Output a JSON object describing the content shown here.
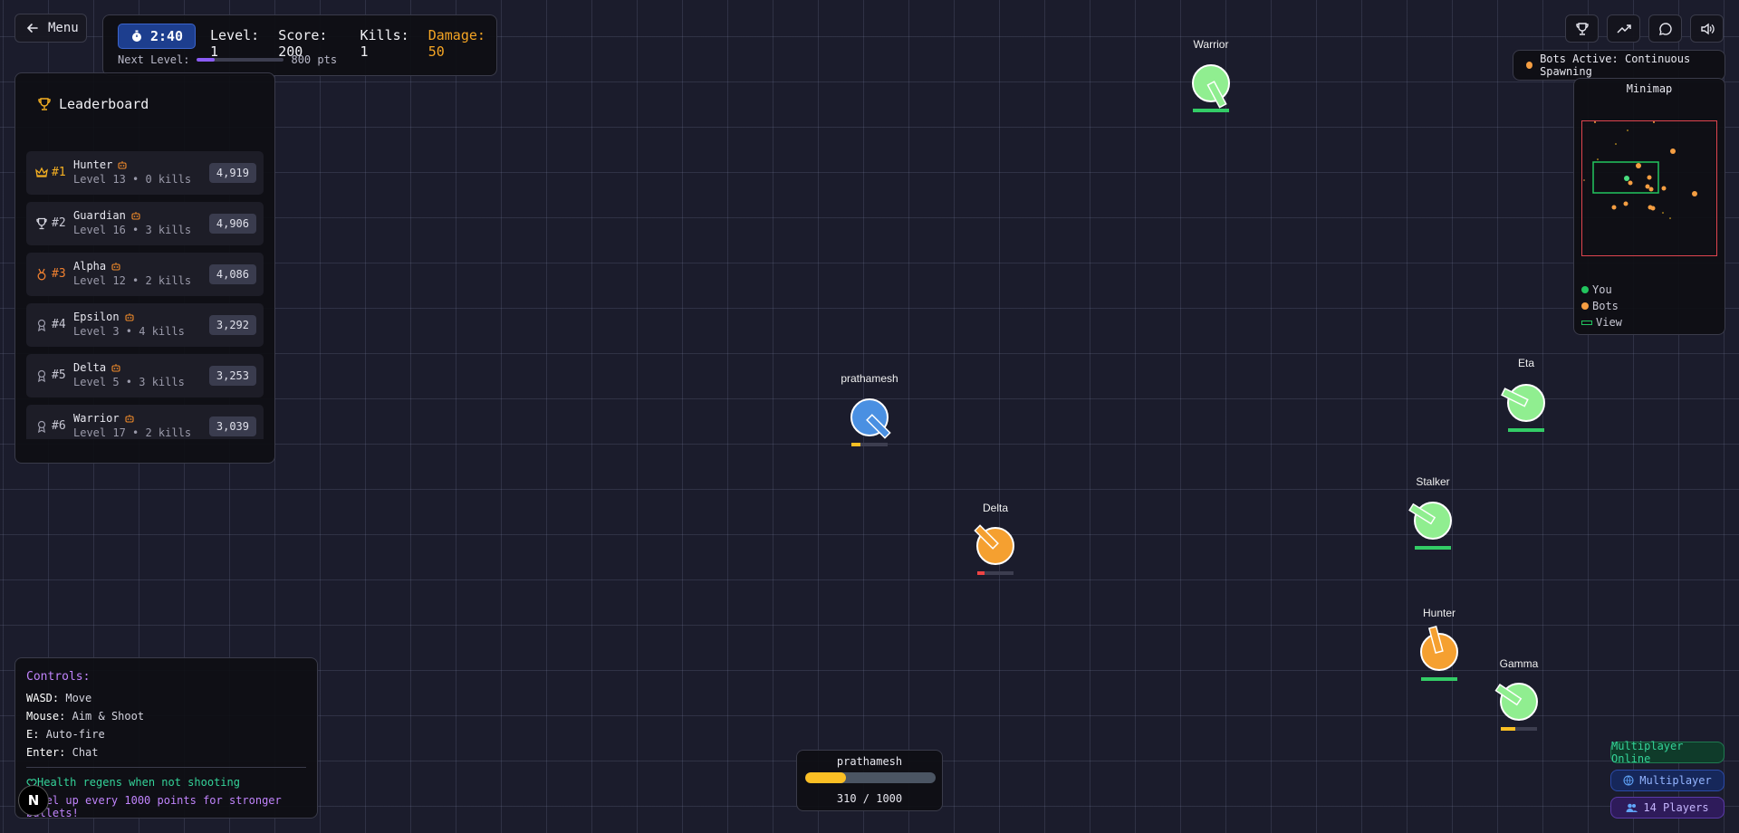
{
  "menu": {
    "label": "Menu"
  },
  "hud": {
    "timer": "2:40",
    "level": "Level: 1",
    "score": "Score: 200",
    "kills": "Kills: 1",
    "damage": "Damage: 50",
    "next_level_label": "Next Level:",
    "next_level_pts": "800 pts",
    "next_level_progress": 0.2
  },
  "leaderboard": {
    "title": "Leaderboard",
    "rows": [
      {
        "rank": "#1",
        "name": "Hunter",
        "sub": "Level 13 • 0 kills",
        "score": "4,919",
        "icon": "crown-icon",
        "style": "gold"
      },
      {
        "rank": "#2",
        "name": "Guardian",
        "sub": "Level 16 • 3 kills",
        "score": "4,906",
        "icon": "trophy-icon",
        "style": "silver"
      },
      {
        "rank": "#3",
        "name": "Alpha",
        "sub": "Level 12 • 2 kills",
        "score": "4,086",
        "icon": "medal-icon",
        "style": "bronze"
      },
      {
        "rank": "#4",
        "name": "Epsilon",
        "sub": "Level 3 • 4 kills",
        "score": "3,292",
        "icon": "award-icon",
        "style": "plain"
      },
      {
        "rank": "#5",
        "name": "Delta",
        "sub": "Level 5 • 3 kills",
        "score": "3,253",
        "icon": "award-icon",
        "style": "plain"
      },
      {
        "rank": "#6",
        "name": "Warrior",
        "sub": "Level 17 • 2 kills",
        "score": "3,039",
        "icon": "award-icon",
        "style": "plain"
      }
    ]
  },
  "controls": {
    "title": "Controls:",
    "lines": [
      {
        "key": "WASD:",
        "action": "Move"
      },
      {
        "key": "Mouse:",
        "action": "Aim & Shoot"
      },
      {
        "key": "E:",
        "action": "Auto-fire"
      },
      {
        "key": "Enter:",
        "action": "Chat"
      }
    ],
    "tip_health": "Health regens when not shooting",
    "tip_level": "Level up every 1000 points for stronger bullets!"
  },
  "logo": {
    "letter": "N"
  },
  "toolbar": {
    "icons": [
      "trophy-icon",
      "trending-up-icon",
      "chat-icon",
      "volume-icon"
    ]
  },
  "bots_status": "Bots Active: Continuous Spawning",
  "minimap": {
    "title": "Minimap",
    "legend_you": "You",
    "legend_bots": "Bots",
    "legend_view": "View"
  },
  "badges": {
    "online": "Multiplayer Online",
    "multiplayer": "Multiplayer",
    "players": "14 Players"
  },
  "player_bar": {
    "name": "prathamesh",
    "text": "310 / 1000",
    "progress": 0.31
  },
  "colors": {
    "player": "#4a90e2",
    "ally": "#90ee90",
    "bot": "#f5a030",
    "health_green": "#33cc66",
    "health_yellow": "#fbbf24",
    "health_red": "#ef4444"
  },
  "entities": [
    {
      "name": "Warrior",
      "type": "ally",
      "health": 1.0
    },
    {
      "name": "prathamesh",
      "type": "player",
      "health": 0.25
    },
    {
      "name": "Eta",
      "type": "ally",
      "health": 1.0
    },
    {
      "name": "Delta",
      "type": "bot",
      "health": 0.2
    },
    {
      "name": "Stalker",
      "type": "ally",
      "health": 1.0
    },
    {
      "name": "Hunter",
      "type": "bot",
      "health": 1.0
    },
    {
      "name": "Gamma",
      "type": "ally",
      "health": 0.4
    }
  ]
}
